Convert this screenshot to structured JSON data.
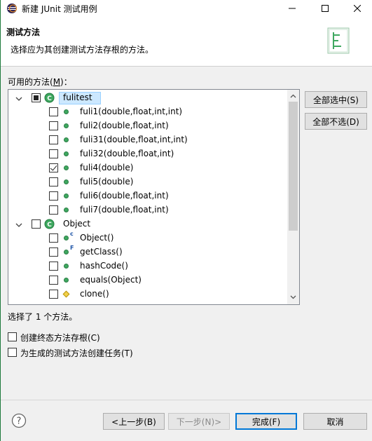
{
  "window": {
    "title": "新建 JUnit 测试用例",
    "minimize_glyph": "—",
    "maximize_glyph": "☐",
    "close_glyph": "✕"
  },
  "banner": {
    "title": "测试方法",
    "description": "选择应为其创建测试方法存根的方法。",
    "icon": "junit-wizard-icon"
  },
  "available": {
    "label_before": "可用的方法(",
    "label_mnemonic": "M",
    "label_after": ")："
  },
  "tree": [
    {
      "type": "class",
      "label": "fulitest",
      "state": "partial",
      "expanded": true,
      "selected": true
    },
    {
      "type": "method",
      "label": "fuli1(double,float,int,int)",
      "checked": false,
      "icon": "public-method-icon"
    },
    {
      "type": "method",
      "label": "fuli2(double,float,int)",
      "checked": false,
      "icon": "public-method-icon"
    },
    {
      "type": "method",
      "label": "fuli31(double,float,int,int)",
      "checked": false,
      "icon": "public-method-icon"
    },
    {
      "type": "method",
      "label": "fuli32(double,float,int)",
      "checked": false,
      "icon": "public-method-icon"
    },
    {
      "type": "method",
      "label": "fuli4(double)",
      "checked": true,
      "icon": "public-method-icon"
    },
    {
      "type": "method",
      "label": "fuli5(double)",
      "checked": false,
      "icon": "public-method-icon"
    },
    {
      "type": "method",
      "label": "fuli6(double,float,int)",
      "checked": false,
      "icon": "public-method-icon"
    },
    {
      "type": "method",
      "label": "fuli7(double,float,int)",
      "checked": false,
      "icon": "public-method-icon"
    },
    {
      "type": "class",
      "label": "Object",
      "state": "unchecked",
      "expanded": true,
      "selected": false
    },
    {
      "type": "method",
      "label": "Object()",
      "checked": false,
      "icon": "constructor-icon",
      "badge": "c"
    },
    {
      "type": "method",
      "label": "getClass()",
      "checked": false,
      "icon": "final-method-icon",
      "badge": "F"
    },
    {
      "type": "method",
      "label": "hashCode()",
      "checked": false,
      "icon": "public-method-icon"
    },
    {
      "type": "method",
      "label": "equals(Object)",
      "checked": false,
      "icon": "public-method-icon"
    },
    {
      "type": "method",
      "label": "clone()",
      "checked": false,
      "icon": "protected-method-icon"
    }
  ],
  "side_buttons": {
    "select_all": "全部选中(S)",
    "deselect_all": "全部不选(D)"
  },
  "status": "选择了 1 个方法。",
  "options": {
    "final_stubs": "创建终态方法存根(C)",
    "create_tasks": "为生成的测试方法创建任务(T)"
  },
  "footer": {
    "back": "<上一步(B)",
    "next": "下一步(N)>",
    "finish": "完成(F)",
    "cancel": "取消",
    "help_glyph": "?"
  },
  "colors": {
    "accent": "#0078d7",
    "method_green": "#3fa860",
    "selection": "#cce8ff"
  }
}
